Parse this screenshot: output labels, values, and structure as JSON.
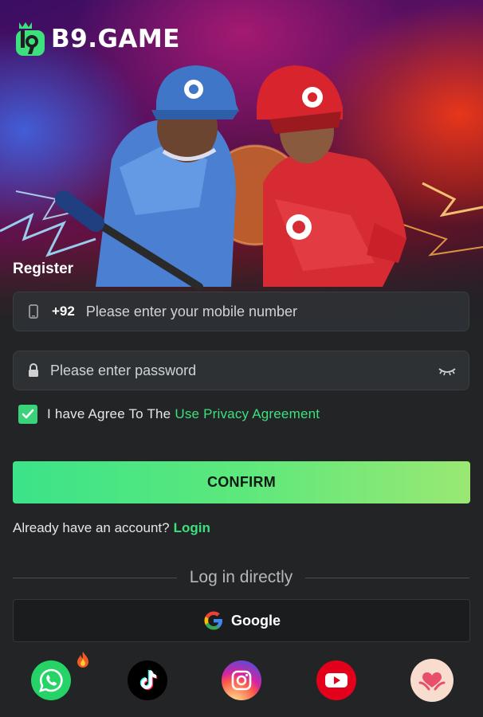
{
  "brand": {
    "name": "B9.GAME",
    "accent": "#3ee07e"
  },
  "register": {
    "title": "Register"
  },
  "phone": {
    "code": "+92",
    "placeholder": "Please enter your mobile number"
  },
  "password": {
    "placeholder": "Please enter password"
  },
  "agree": {
    "checked": true,
    "text": "I have Agree To The",
    "link": "Use Privacy Agreement"
  },
  "confirm": {
    "label": "CONFIRM"
  },
  "account": {
    "text": "Already have an account?",
    "link": "Login"
  },
  "direct": {
    "label": "Log in directly"
  },
  "google": {
    "label": "Google"
  },
  "social": [
    {
      "icon": "whatsapp-icon",
      "color": "#25d366"
    },
    {
      "icon": "tiktok-icon",
      "color": "#000000"
    },
    {
      "icon": "instagram-icon",
      "color": "#d6249f"
    },
    {
      "icon": "youtube-icon",
      "color": "#ff0000"
    },
    {
      "icon": "heart-hands-icon",
      "color": "#f7d7c8"
    }
  ]
}
